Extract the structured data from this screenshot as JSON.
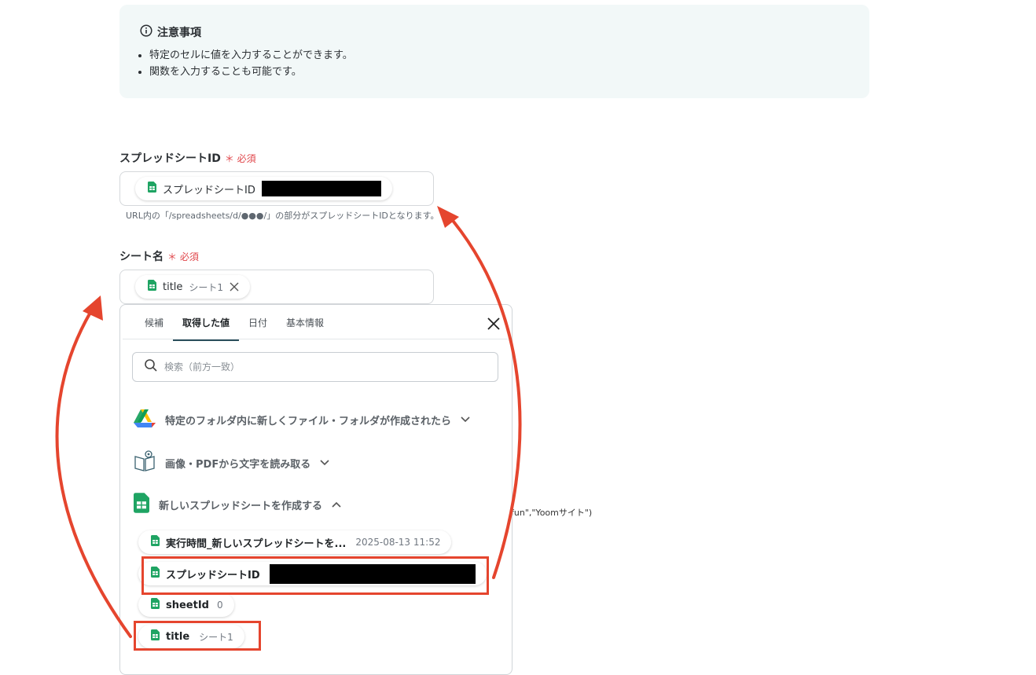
{
  "notice": {
    "title": "注意事項",
    "items": [
      "特定のセルに値を入力することができます。",
      "関数を入力することも可能です。"
    ]
  },
  "spreadsheet_field": {
    "label": "スプレッドシートID",
    "required": "必須",
    "chip_label": "スプレッドシートID",
    "hint": "URL内の「/spreadsheets/d/●●●/」の部分がスプレッドシートIDとなります。"
  },
  "sheet_field": {
    "label": "シート名",
    "required": "必須",
    "chip_label": "title",
    "chip_value": "シート1"
  },
  "picker": {
    "tabs": [
      "候補",
      "取得した値",
      "日付",
      "基本情報"
    ],
    "active_tab": "取得した値",
    "search_placeholder": "検索（前方一致）",
    "groups": [
      {
        "label": "特定のフォルダ内に新しくファイル・フォルダが作成されたら",
        "icon": "google-drive-icon"
      },
      {
        "label": "画像・PDFから文字を読み取る",
        "icon": "ocr-book-icon"
      },
      {
        "label": "新しいスプレッドシートを作成する",
        "icon": "google-sheets-icon"
      }
    ],
    "values": [
      {
        "label": "実行時間_新しいスプレッドシートを...",
        "value": "2025-08-13 11:52"
      },
      {
        "label": "スプレッドシートID",
        "value": ""
      },
      {
        "label": "sheetId",
        "value": "0"
      },
      {
        "label": "title",
        "value": "シート1"
      }
    ]
  },
  "background_text": "fun\",\"Yoomサイト\")",
  "colors": {
    "accent_red": "#e5452e",
    "sheets_green": "#1fa463",
    "notice_bg": "#f2f8f8",
    "required_red": "#e0454a"
  }
}
